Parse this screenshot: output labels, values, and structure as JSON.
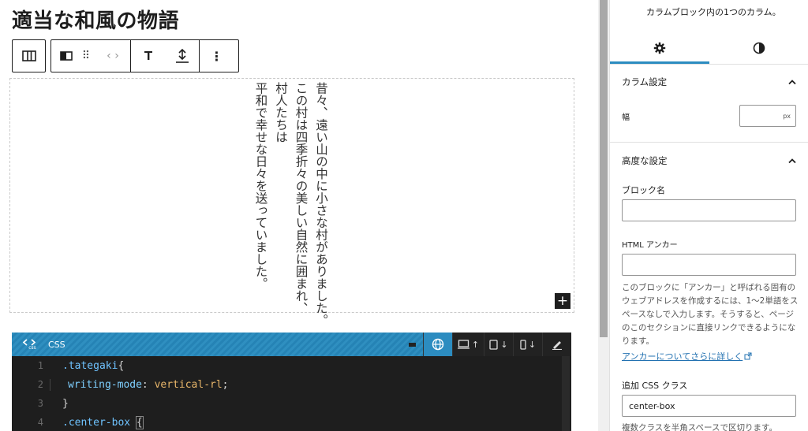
{
  "editor": {
    "page_title": "適当な和風の物語",
    "toolbar": {
      "drag_glyph": "⠿",
      "move_glyph": "‹ ›",
      "more_glyph": "⋮"
    },
    "story_lines": [
      "昔々、遠い山の中に小さな村がありました。",
      "この村は四季折々の美しい自然に囲まれ、",
      "村人たちは",
      "平和で幸せな日々を送っていました。"
    ],
    "add_block_glyph": "+"
  },
  "code_block": {
    "label": "CSS",
    "icon_caption": "css",
    "actions": {
      "desktop_arrow": "↑",
      "tablet_arrow": "↓",
      "mobile_arrow": "↓"
    },
    "lines": [
      {
        "n": "1",
        "selector": ".tategaki",
        "open": "{"
      },
      {
        "n": "2",
        "prop": "writing-mode",
        "value": "vertical-rl",
        "end": ";"
      },
      {
        "n": "3",
        "close": "}"
      },
      {
        "n": "4",
        "selector": ".center-box",
        "open": "{"
      }
    ]
  },
  "sidebar": {
    "description": "カラムブロック内の1つのカラム。",
    "column_settings": {
      "title": "カラム設定",
      "width_label": "幅",
      "width_unit": "px"
    },
    "advanced": {
      "title": "高度な設定",
      "block_name_label": "ブロック名",
      "block_name_value": "",
      "anchor_label": "HTML アンカー",
      "anchor_value": "",
      "anchor_help": "このブロックに「アンカー」と呼ばれる固有のウェブアドレスを作成するには、1〜2単語をスペースなしで入力します。そうすると、ページのこのセクションに直接リンクできるようになります。",
      "anchor_link": "アンカーについてさらに詳しく",
      "css_class_label": "追加 CSS クラス",
      "css_class_value": "center-box",
      "css_class_help": "複数クラスを半角スペースで区切ります。"
    }
  },
  "colors": {
    "accent": "#2c8cc0",
    "link": "#2271b1",
    "code_bg": "#1e1e1e"
  }
}
